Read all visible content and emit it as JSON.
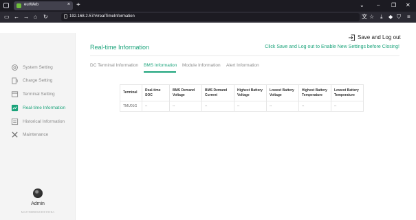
{
  "browser": {
    "tab_title": "eurWeb",
    "tab_close": "×",
    "new_tab": "+",
    "url": "192.168.2.57/#/realTimeInformation",
    "window_controls": [
      "⌄",
      "–",
      "❐",
      "✕"
    ]
  },
  "toolbar": {
    "back": "←",
    "forward": "→",
    "reload": "↻",
    "home": "⌂"
  },
  "sidebar": {
    "items": [
      {
        "label": "System Setting",
        "icon": "gear-icon"
      },
      {
        "label": "Charge Setting",
        "icon": "charge-icon"
      },
      {
        "label": "Terminal Setting",
        "icon": "terminal-icon"
      },
      {
        "label": "Real-time Information",
        "icon": "chart-icon",
        "active": true
      },
      {
        "label": "Historical Information",
        "icon": "history-icon"
      },
      {
        "label": "Maintenance",
        "icon": "tools-icon"
      }
    ],
    "admin_name": "Admin",
    "mac": "MAC:0808:B4:E3:C8:8A"
  },
  "header": {
    "save_logout": "Save and Log out",
    "title": "Real-time Information",
    "notice": "Click Save and Log out to Enable New Settings before Closing!"
  },
  "tabs": [
    {
      "label": "DC Terminal Information"
    },
    {
      "label": "BMS Information",
      "active": true
    },
    {
      "label": "Module Information"
    },
    {
      "label": "Alert Information"
    }
  ],
  "table": {
    "headers": [
      "Terminal",
      "Real-time SOC",
      "BMS Demand Voltage",
      "BMS Demand Current",
      "Highest Battery Voltage",
      "Lowest Battery Voltage",
      "Highest Battery Temperature",
      "Lowest Battery Temperature"
    ],
    "rows": [
      [
        "TMU01G",
        "--",
        "--",
        "--",
        "--",
        "--",
        "--",
        "--"
      ]
    ]
  },
  "colors": {
    "accent": "#1aa37a",
    "sidebar_bg": "#f4f4f4",
    "browser_dark": "#1c1b22"
  }
}
